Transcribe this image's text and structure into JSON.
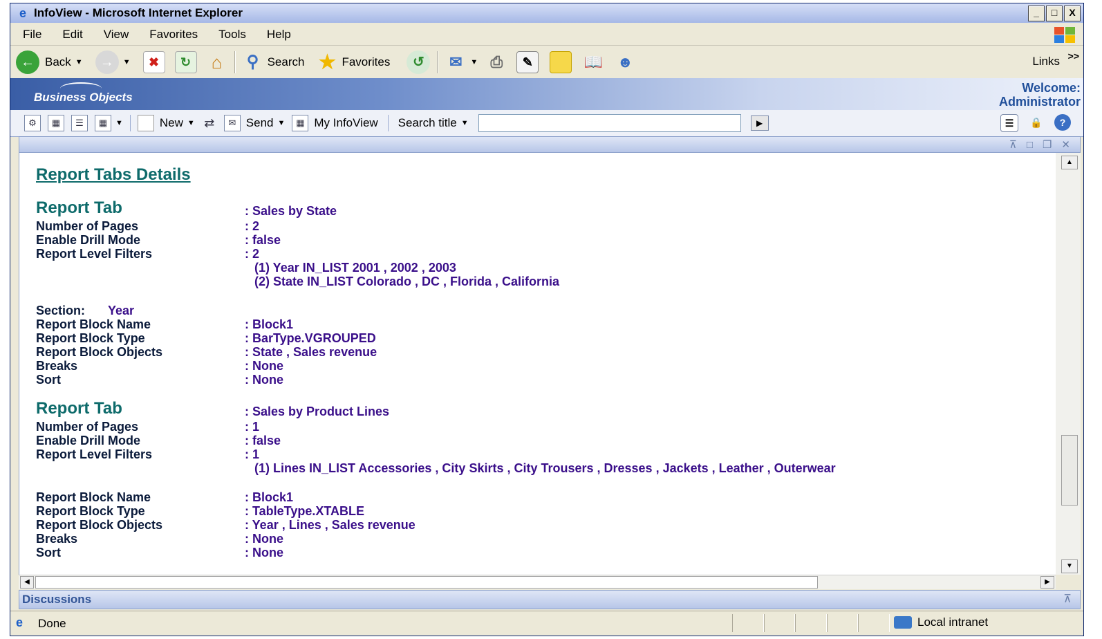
{
  "window": {
    "title": "InfoView - Microsoft Internet Explorer",
    "controls": [
      "_",
      "□",
      "X"
    ]
  },
  "menu": [
    "File",
    "Edit",
    "View",
    "Favorites",
    "Tools",
    "Help"
  ],
  "toolbar": {
    "back": "Back",
    "search": "Search",
    "favorites": "Favorites",
    "links": "Links",
    "more": ">>"
  },
  "bo": {
    "logo": "Business Objects",
    "welcome_line1": "Welcome:",
    "welcome_line2": "Administrator"
  },
  "bo_toolbar": {
    "new": "New",
    "send": "Send",
    "my_infoview": "My InfoView",
    "search_title": "Search title",
    "search_value": ""
  },
  "report": {
    "page_title": "Report Tabs Details",
    "tabs": [
      {
        "heading": "Report Tab",
        "name": ": Sales by State",
        "num_pages_label": "Number of Pages",
        "num_pages": ": 2",
        "drill_label": "Enable Drill Mode",
        "drill": ": false",
        "filters_label": "Report Level Filters",
        "filters_count": ": 2",
        "filters": [
          "(1)  Year  IN_LIST  2001 ,  2002 ,  2003",
          "(2)  State  IN_LIST  Colorado ,  DC ,  Florida ,  California"
        ],
        "section_label": "Section:",
        "section_value": "Year",
        "block_name_label": "Report Block Name",
        "block_name": ": Block1",
        "block_type_label": "Report Block Type",
        "block_type": ": BarType.VGROUPED",
        "block_objects_label": "Report Block Objects",
        "block_objects": ": State ,  Sales revenue",
        "breaks_label": "Breaks",
        "breaks": ":   None",
        "sort_label": "Sort",
        "sort": ":   None"
      },
      {
        "heading": "Report Tab",
        "name": ": Sales by Product Lines",
        "num_pages_label": "Number of Pages",
        "num_pages": ": 1",
        "drill_label": "Enable Drill Mode",
        "drill": ": false",
        "filters_label": "Report Level Filters",
        "filters_count": ": 1",
        "filters": [
          "(1)  Lines  IN_LIST  Accessories ,  City Skirts ,  City Trousers ,  Dresses ,  Jackets ,  Leather ,  Outerwear"
        ],
        "block_name_label": "Report Block Name",
        "block_name": ": Block1",
        "block_type_label": "Report Block Type",
        "block_type": ": TableType.XTABLE",
        "block_objects_label": "Report Block Objects",
        "block_objects": ": Year ,  Lines ,  Sales revenue",
        "breaks_label": "Breaks",
        "breaks": ":   None",
        "sort_label": "Sort",
        "sort": ":   None"
      }
    ]
  },
  "discussions": "Discussions",
  "status": {
    "text": "Done",
    "zone": "Local intranet"
  },
  "colors": {
    "title_gradient": "#a6b8e6",
    "bo_blue": "#3a5ea6",
    "heading_teal": "#0e6b6b",
    "value_purple": "#3a0f8a"
  }
}
